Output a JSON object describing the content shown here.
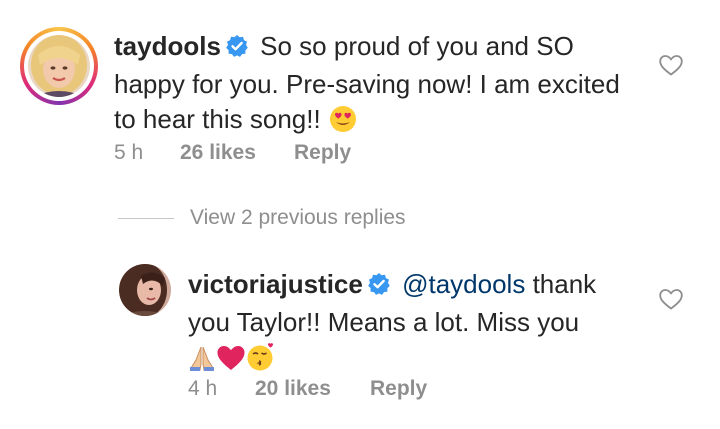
{
  "comment": {
    "username": "taydools",
    "verified": true,
    "text": "So so proud of you and SO happy for you. Pre-saving now! I am excited to hear this song!!",
    "emoji": "heart-eyes-emoji",
    "time": "5 h",
    "likes": "26 likes",
    "reply_label": "Reply"
  },
  "replies_toggle": {
    "label": "View 2 previous replies"
  },
  "reply": {
    "username": "victoriajustice",
    "verified": true,
    "mention": "@taydools",
    "text": "thank you Taylor!! Means a lot. Miss you",
    "emojis": [
      "folded-hands-emoji",
      "red-heart-emoji",
      "kissing-face-emoji"
    ],
    "time": "4 h",
    "likes": "20 likes",
    "reply_label": "Reply"
  },
  "colors": {
    "text": "#262626",
    "secondary": "#8e8e8e",
    "mention": "#00376b",
    "verified": "#3897f0",
    "heart_red": "#e0245e"
  }
}
